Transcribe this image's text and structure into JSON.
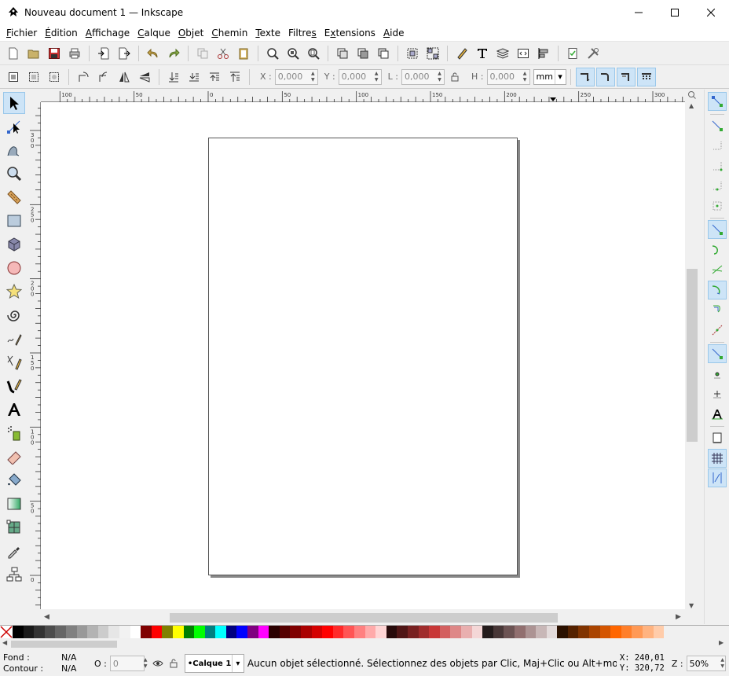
{
  "window": {
    "title": "Nouveau document 1 — Inkscape"
  },
  "menu": [
    {
      "key": "F",
      "rest": "ichier"
    },
    {
      "key": "É",
      "rest": "dition"
    },
    {
      "key": "A",
      "rest": "ffichage"
    },
    {
      "key": "C",
      "rest": "alque"
    },
    {
      "key": "O",
      "rest": "bjet"
    },
    {
      "key": "C",
      "rest": "hemin"
    },
    {
      "key": "T",
      "rest": "exte"
    },
    {
      "key": "F",
      "rest": "iltres",
      "underline_last": true
    },
    {
      "key": "E",
      "rest": "xtensions",
      "underline_pos": 1
    },
    {
      "key": "A",
      "rest": "ide"
    }
  ],
  "toolbar2": {
    "x_label": "X :",
    "y_label": "Y :",
    "w_label": "L :",
    "h_label": "H :",
    "x_value": "0,000",
    "y_value": "0,000",
    "w_value": "0,000",
    "h_value": "0,000",
    "unit": "mm"
  },
  "rulers": {
    "h_labels": [
      "100",
      "50",
      "0",
      "50",
      "100",
      "150",
      "200",
      "250",
      "300"
    ],
    "v_labels": [
      "3 0 0",
      "2 5 0",
      "2 0 0",
      "1 5 0",
      "1 0 0",
      "5 0",
      "0"
    ]
  },
  "status": {
    "fill_label": "Fond :",
    "fill_value": "N/A",
    "stroke_label": "Contour :",
    "stroke_value": "N/A",
    "opacity_label": "O :",
    "opacity_value": "0",
    "layer": "•Calque 1",
    "message": "Aucun objet sélectionné. Sélectionnez des objets par Clic, Maj+Clic ou Alt+molette, ou …",
    "x_readout": "X:  240,01",
    "y_readout": "Y:  320,72",
    "zoom_label": "Z :",
    "zoom_value": "50%"
  },
  "palette": [
    "#000000",
    "#1a1a1a",
    "#333333",
    "#4d4d4d",
    "#666666",
    "#808080",
    "#999999",
    "#b3b3b3",
    "#cccccc",
    "#e6e6e6",
    "#f2f2f2",
    "#ffffff",
    "#800000",
    "#ff0000",
    "#808000",
    "#ffff00",
    "#008000",
    "#00ff00",
    "#008080",
    "#00ffff",
    "#000080",
    "#0000ff",
    "#800080",
    "#ff00ff",
    "#2b0000",
    "#550000",
    "#800000",
    "#aa0000",
    "#d40000",
    "#ff0000",
    "#ff2a2a",
    "#ff5555",
    "#ff8080",
    "#ffaaaa",
    "#ffd5d5",
    "#280b0b",
    "#501616",
    "#782121",
    "#a02c2c",
    "#c83737",
    "#d35f5f",
    "#de8787",
    "#e9afaf",
    "#f4d7d7",
    "#241c1c",
    "#483737",
    "#6c5353",
    "#916f6f",
    "#ac9393",
    "#c8b7b7",
    "#e3dbdb",
    "#2b1100",
    "#552200",
    "#803300",
    "#aa4400",
    "#d45500",
    "#ff6600",
    "#ff7f2a",
    "#ff9955",
    "#ffb380",
    "#ffccaa"
  ]
}
